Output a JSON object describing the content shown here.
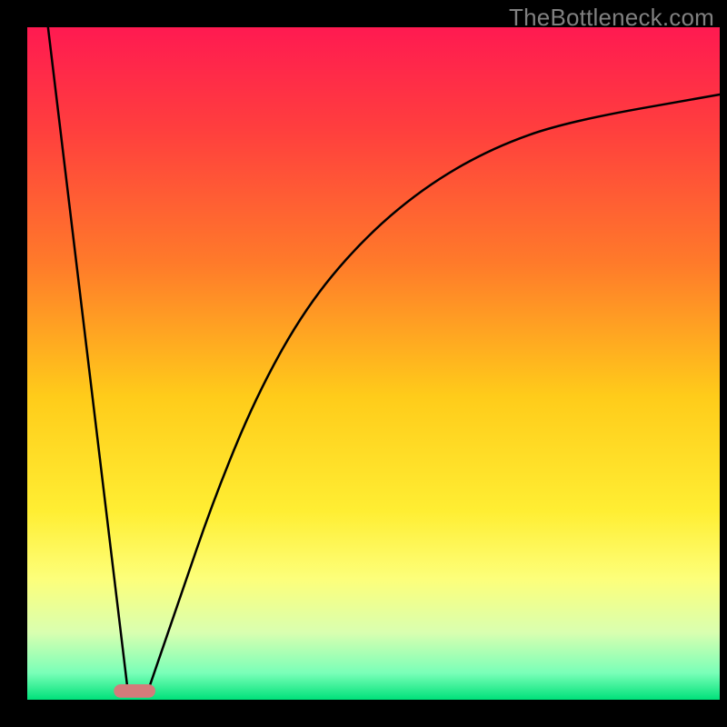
{
  "watermark": "TheBottleneck.com",
  "chart_data": {
    "type": "line",
    "title": "",
    "xlabel": "",
    "ylabel": "",
    "xlim": [
      0,
      100
    ],
    "ylim": [
      0,
      100
    ],
    "background": {
      "type": "vertical_gradient",
      "stops": [
        {
          "pos": 0.0,
          "color": "#ff1a51"
        },
        {
          "pos": 0.15,
          "color": "#ff3e3e"
        },
        {
          "pos": 0.35,
          "color": "#ff7a2a"
        },
        {
          "pos": 0.55,
          "color": "#ffcc1a"
        },
        {
          "pos": 0.72,
          "color": "#ffee33"
        },
        {
          "pos": 0.82,
          "color": "#fdff7a"
        },
        {
          "pos": 0.9,
          "color": "#d9ffb0"
        },
        {
          "pos": 0.96,
          "color": "#7affb8"
        },
        {
          "pos": 1.0,
          "color": "#00e17a"
        }
      ]
    },
    "border_color": "#000000",
    "marker": {
      "x": 15.5,
      "y": 1.3,
      "width": 6.0,
      "height": 2.0,
      "rx": 1.0,
      "fill": "#d47b7b"
    },
    "series": [
      {
        "name": "left-branch",
        "type": "line",
        "x": [
          3.0,
          14.5
        ],
        "y": [
          100.0,
          1.5
        ]
      },
      {
        "name": "right-branch",
        "type": "curve",
        "x": [
          17.5,
          22,
          27,
          33,
          40,
          48,
          57,
          67,
          78,
          100
        ],
        "y": [
          1.5,
          15,
          30,
          45,
          58,
          68,
          76,
          82,
          86,
          90
        ]
      }
    ]
  }
}
